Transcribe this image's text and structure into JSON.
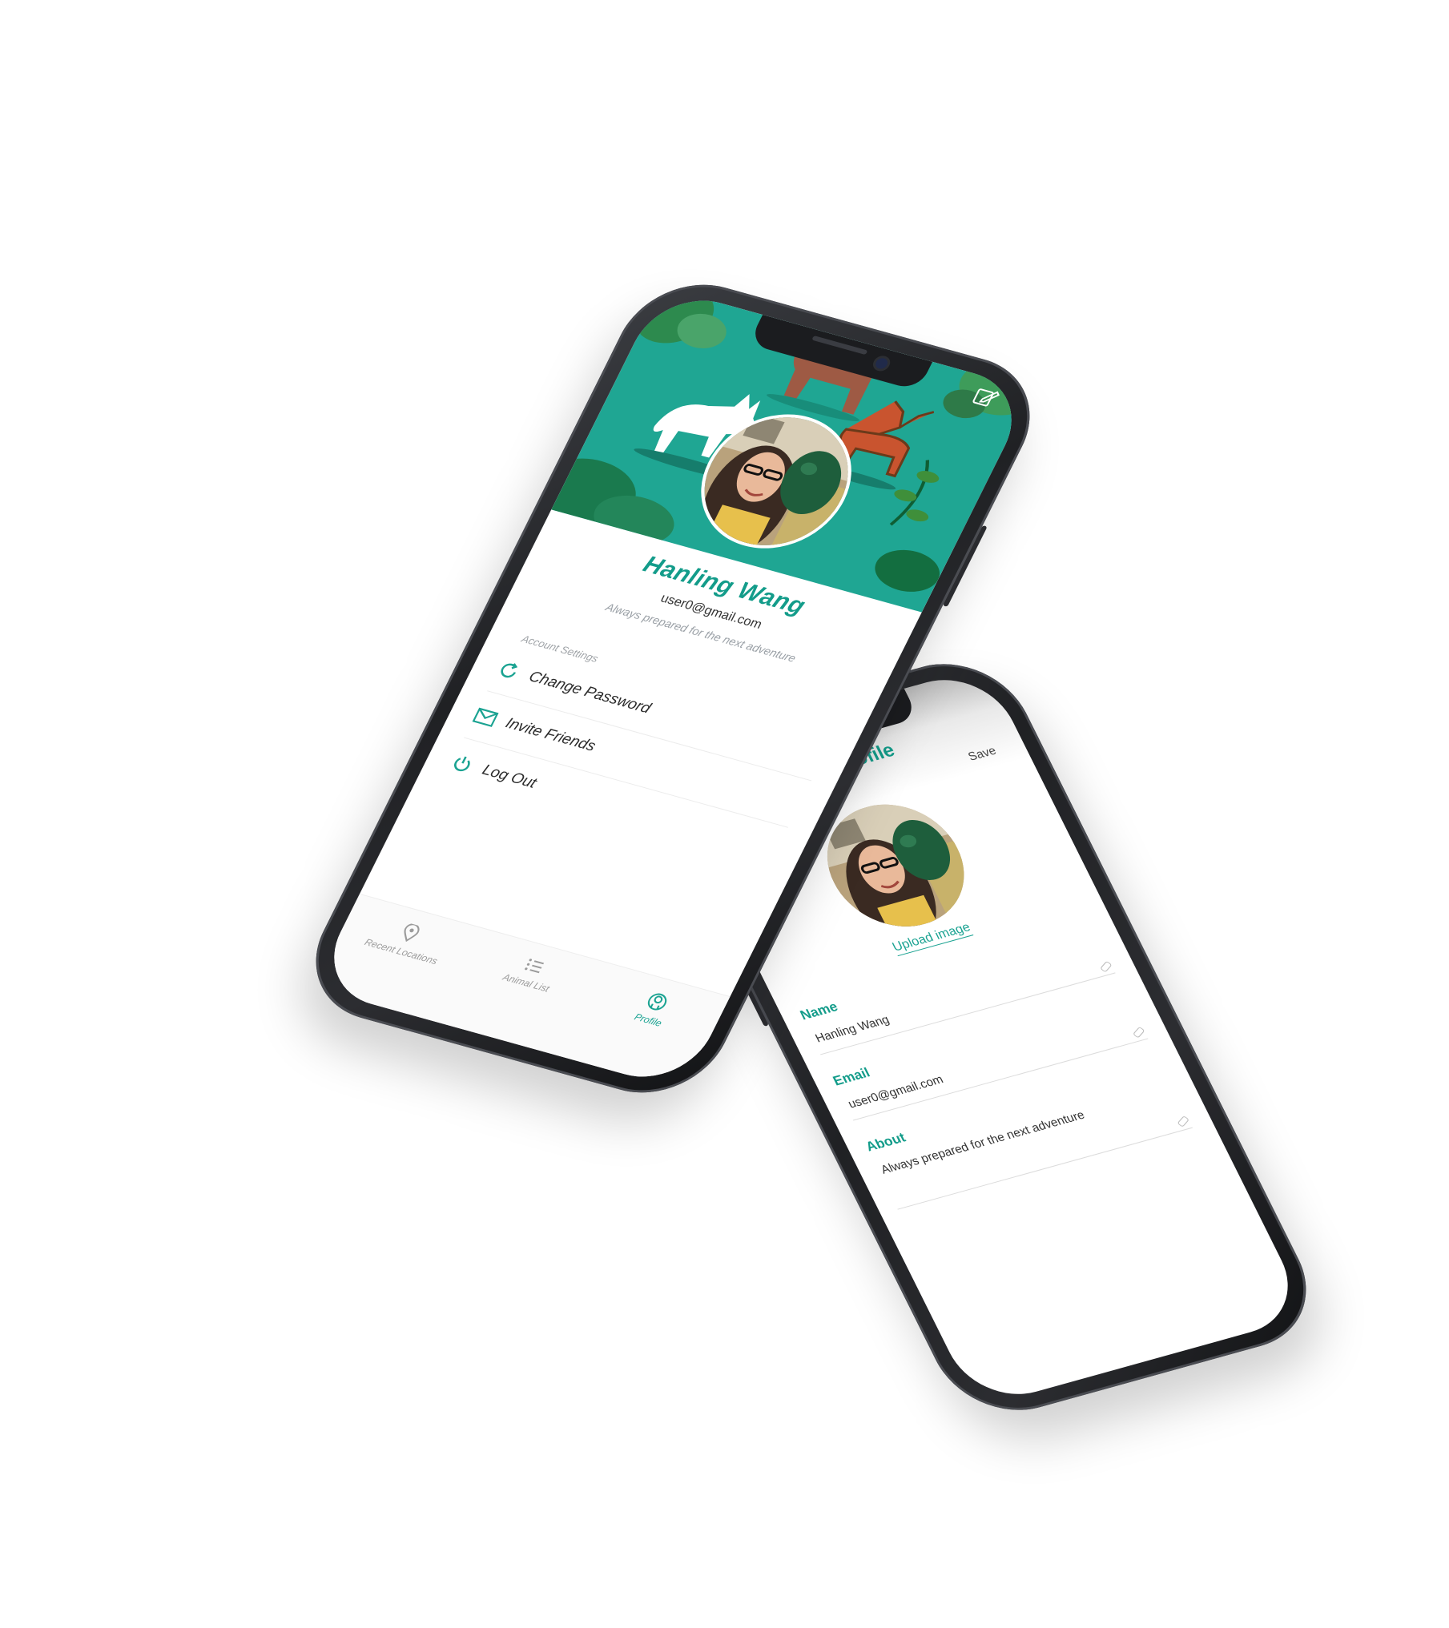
{
  "profile_screen": {
    "name": "Hanling Wang",
    "email": "user0@gmail.com",
    "about": "Always prepared for the next adventure",
    "settings_label": "Account Settings",
    "menu": [
      {
        "label": "Change Password",
        "icon": "refresh-icon"
      },
      {
        "label": "Invite Friends",
        "icon": "mail-icon"
      },
      {
        "label": "Log Out",
        "icon": "power-icon"
      }
    ],
    "tabs": [
      {
        "label": "Recent Locations",
        "icon": "location-pin-icon",
        "active": false
      },
      {
        "label": "Animal List",
        "icon": "list-icon",
        "active": false
      },
      {
        "label": "Profile",
        "icon": "profile-icon",
        "active": true
      }
    ]
  },
  "edit_screen": {
    "title": "Edit Profile",
    "save_label": "Save",
    "upload_label": "Upload image",
    "fields": [
      {
        "label": "Name",
        "value": "Hanling Wang"
      },
      {
        "label": "Email",
        "value": "user0@gmail.com"
      },
      {
        "label": "About",
        "value": "Always prepared for the next adventure"
      }
    ]
  },
  "colors": {
    "accent": "#1ba392",
    "header_bg": "#1fa693",
    "frame": "#202124"
  }
}
